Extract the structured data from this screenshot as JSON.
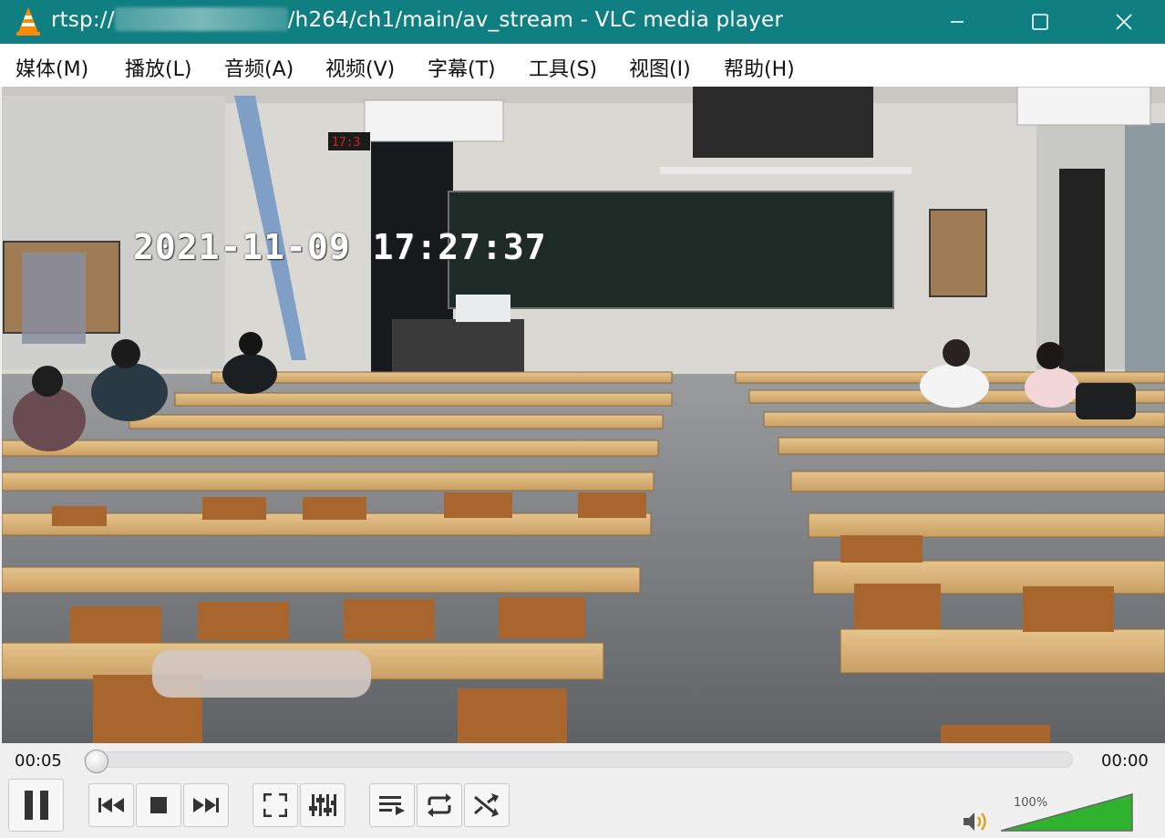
{
  "window": {
    "title_prefix": "rtsp://",
    "title_suffix": "/h264/ch1/main/av_stream - VLC media player",
    "icon": "vlc-cone-icon",
    "controls": [
      "minimize-icon",
      "maximize-icon",
      "close-icon"
    ]
  },
  "menu": [
    {
      "label": "媒体(M)",
      "underline": "M"
    },
    {
      "label": "播放(L)",
      "underline": "L"
    },
    {
      "label": "音频(A)",
      "underline": "A"
    },
    {
      "label": "视频(V)",
      "underline": "V"
    },
    {
      "label": "字幕(T)",
      "underline": "T"
    },
    {
      "label": "工具(S)",
      "underline": "S"
    },
    {
      "label": "视图(I)",
      "underline": "I"
    },
    {
      "label": "帮助(H)",
      "underline": "H"
    }
  ],
  "video": {
    "osd_timestamp": "2021-11-09 17:27:37",
    "wall_clock": "17:3"
  },
  "controls": {
    "time_elapsed": "00:05",
    "time_total": "00:00",
    "seek_position": 0,
    "volume_percent": "100%",
    "volume_level": 1.0,
    "buttons": [
      "pause-icon",
      "previous-icon",
      "stop-icon",
      "next-icon",
      "fullscreen-icon",
      "extended-settings-icon",
      "playlist-icon",
      "loop-icon",
      "shuffle-icon"
    ],
    "accent": "#2fb32f"
  }
}
